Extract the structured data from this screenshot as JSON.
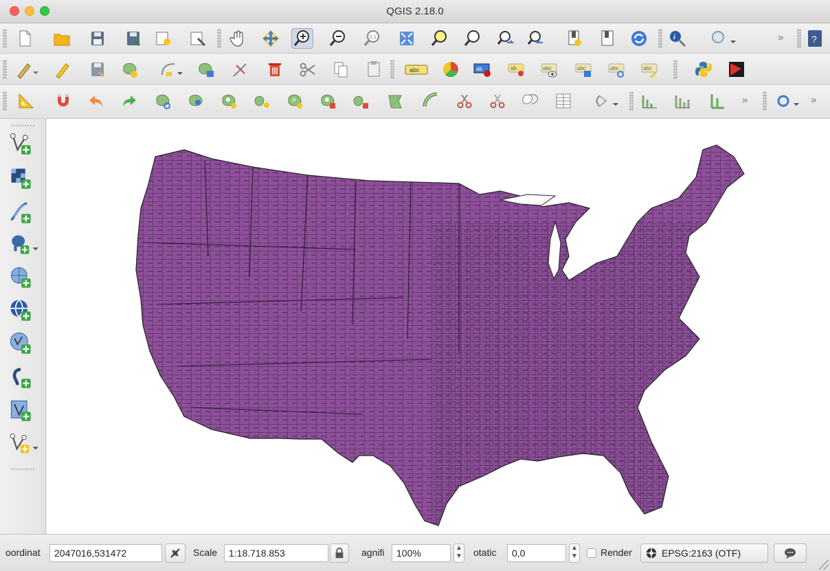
{
  "window": {
    "title": "QGIS 2.18.0"
  },
  "toolbars": {
    "file": [
      "new-project-icon",
      "open-project-icon",
      "save-project-icon",
      "save-as-icon",
      "new-print-composer-icon",
      "composer-manager-icon"
    ],
    "navigation": [
      "pan-icon",
      "pan-to-selection-icon",
      "zoom-in-icon",
      "zoom-out-icon",
      "zoom-native-icon",
      "zoom-full-icon",
      "zoom-to-selection-icon",
      "zoom-to-layer-icon",
      "zoom-last-icon",
      "zoom-next-icon",
      "new-bookmark-icon",
      "show-bookmarks-icon",
      "refresh-icon",
      "identify-icon",
      "select-features-icon",
      "help-icon"
    ],
    "digitizing": [
      "toggle-editing-pencil-icon",
      "current-edits-icon",
      "save-edits-icon",
      "add-feature-icon",
      "move-feature-icon",
      "node-tool-icon",
      "delete-selected-icon",
      "cut-features-icon",
      "copy-features-icon",
      "paste-features-icon"
    ],
    "labels": [
      "label-tool-icon",
      "diagram-icon",
      "pin-labels-icon",
      "highlight-pinned-labels-icon",
      "show-hide-labels-icon",
      "move-label-icon",
      "rotate-label-icon",
      "change-label-icon",
      "python-console-icon",
      "plugin-k-icon"
    ],
    "advanced_digitizing": [
      "measure-icon",
      "snapping-magnet-icon",
      "undo-icon",
      "redo-icon",
      "rotate-feature-icon",
      "simplify-feature-icon",
      "add-ring-icon",
      "add-part-icon",
      "fill-ring-icon",
      "delete-ring-icon",
      "delete-part-icon",
      "reshape-features-icon",
      "offset-curve-icon",
      "split-features-icon",
      "split-parts-icon",
      "merge-features-icon",
      "merge-attributes-icon",
      "rotate-point-symbols-icon",
      "spatial-query-icon"
    ],
    "overflow_symbol": "»"
  },
  "left_toolbar": [
    "add-vector-layer-icon",
    "add-raster-layer-icon",
    "add-delimited-text-icon",
    "add-postgis-layer-icon",
    "add-spatialite-layer-icon",
    "add-wms-layer-icon",
    "add-wfs-layer-icon",
    "add-virtual-layer-icon",
    "new-shapefile-layer-icon",
    "new-spatialite-layer-icon"
  ],
  "map": {
    "fill_color": "#8e4f9a",
    "stroke_color": "#222222",
    "layer": "US counties"
  },
  "statusbar": {
    "coordinate_label": "oordinat",
    "coordinate_value": "2047016,531472",
    "scale_label": "Scale",
    "scale_value": "1:18.718.853",
    "magnifier_label": "agnifi",
    "magnifier_value": "100%",
    "rotation_label": "otatic",
    "rotation_value": "0,0",
    "render_label": "Render",
    "crs_label": "EPSG:2163 (OTF)"
  }
}
